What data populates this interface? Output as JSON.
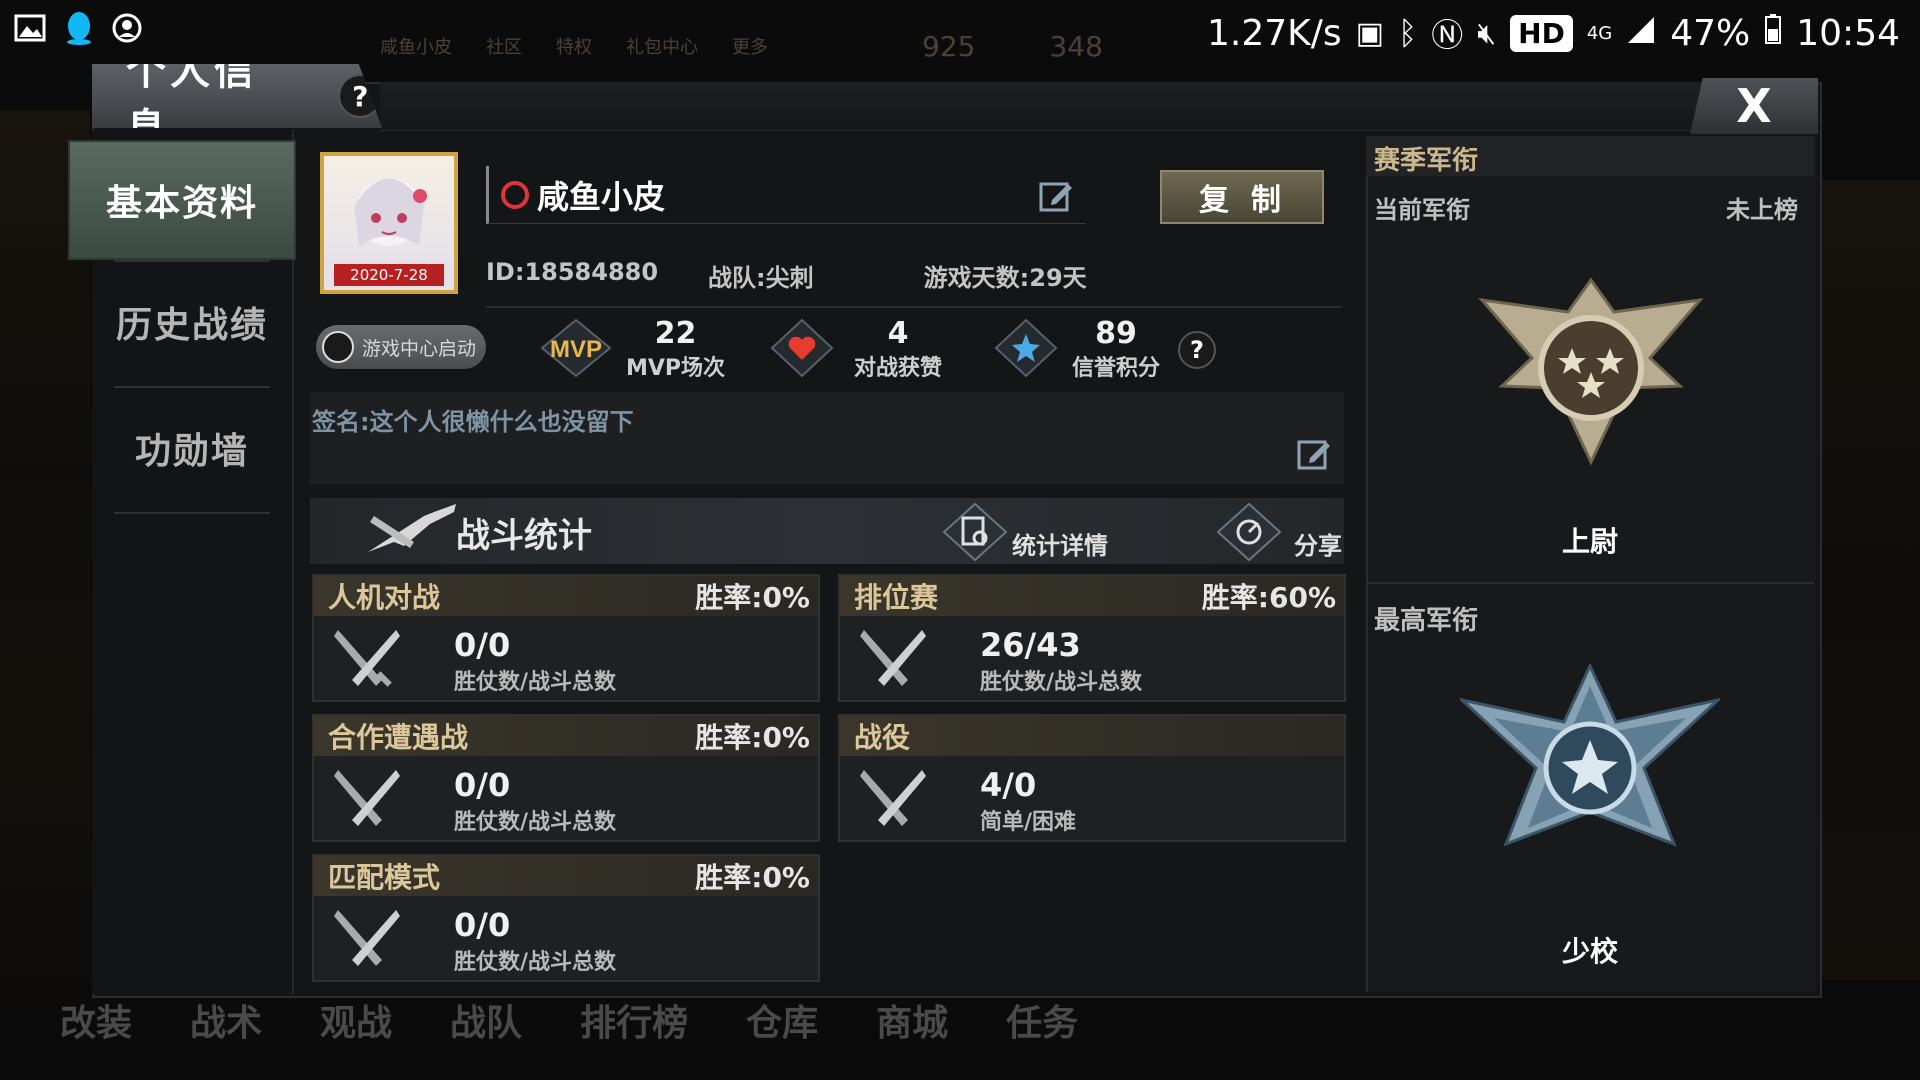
{
  "status_bar": {
    "speed": "1.27K/s",
    "hd": "HD",
    "network": "4G",
    "battery": "47%",
    "time": "10:54"
  },
  "background": {
    "top_items": [
      "咸鱼小皮",
      "社区",
      "特权",
      "礼包中心",
      "更多",
      "925",
      "348"
    ],
    "bottom_items": [
      "改装",
      "战术",
      "观战",
      "战队",
      "排行榜",
      "仓库",
      "商城",
      "任务"
    ]
  },
  "window": {
    "title": "个人信息",
    "help": "?",
    "close": "X"
  },
  "nav": {
    "items": [
      {
        "label": "基本资料",
        "active": true
      },
      {
        "label": "历史战绩",
        "active": false
      },
      {
        "label": "功勋墙",
        "active": false
      }
    ]
  },
  "profile": {
    "avatar_date": "2020-7-28",
    "name": "咸鱼小皮",
    "copy_label": "复制",
    "id_text": "ID:18584880",
    "team_text": "战队:尖刺",
    "days_text": "游戏天数:29天",
    "game_center_label": "游戏中心启动",
    "stats": [
      {
        "icon": "mvp-icon",
        "value": "22",
        "label": "MVP场次"
      },
      {
        "icon": "heart-icon",
        "value": "4",
        "label": "对战获赞"
      },
      {
        "icon": "star-icon",
        "value": "89",
        "label": "信誉积分"
      }
    ],
    "signature": "签名:这个人很懒什么也没留下"
  },
  "battle": {
    "title": "战斗统计",
    "details_label": "统计详情",
    "share_label": "分享",
    "cards": [
      {
        "name": "人机对战",
        "rate": "胜率:0%",
        "value": "0/0",
        "sub": "胜仗数/战斗总数"
      },
      {
        "name": "排位赛",
        "rate": "胜率:60%",
        "value": "26/43",
        "sub": "胜仗数/战斗总数"
      },
      {
        "name": "合作遭遇战",
        "rate": "胜率:0%",
        "value": "0/0",
        "sub": "胜仗数/战斗总数"
      },
      {
        "name": "战役",
        "rate": "",
        "value": "4/0",
        "sub": "简单/困难"
      },
      {
        "name": "匹配模式",
        "rate": "胜率:0%",
        "value": "0/0",
        "sub": "胜仗数/战斗总数"
      }
    ]
  },
  "rank": {
    "section_title": "赛季军衔",
    "current_label": "当前军衔",
    "current_status": "未上榜",
    "current_rank": "上尉",
    "highest_label": "最高军衔",
    "highest_rank": "少校"
  }
}
